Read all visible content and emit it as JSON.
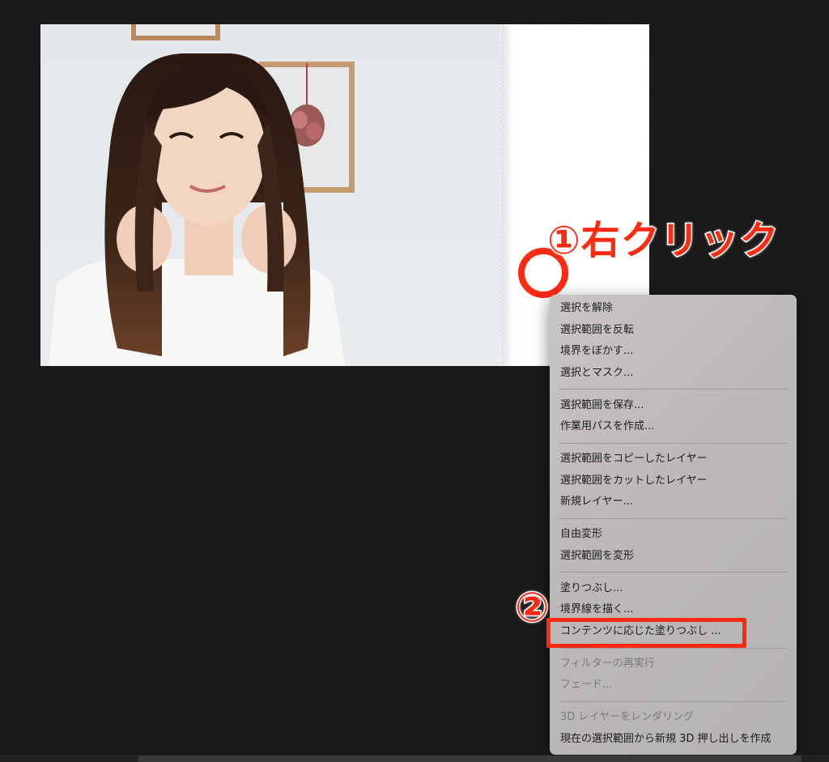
{
  "annotations": {
    "step1": "①右クリック",
    "step2": "②"
  },
  "context_menu": {
    "groups": [
      {
        "items": [
          {
            "label": "選択を解除",
            "enabled": true
          },
          {
            "label": "選択範囲を反転",
            "enabled": true
          },
          {
            "label": "境界をぼかす...",
            "enabled": true
          },
          {
            "label": "選択とマスク...",
            "enabled": true
          }
        ]
      },
      {
        "items": [
          {
            "label": "選択範囲を保存...",
            "enabled": true
          },
          {
            "label": "作業用パスを作成...",
            "enabled": true
          }
        ]
      },
      {
        "items": [
          {
            "label": "選択範囲をコピーしたレイヤー",
            "enabled": true
          },
          {
            "label": "選択範囲をカットしたレイヤー",
            "enabled": true
          },
          {
            "label": "新規レイヤー...",
            "enabled": true
          }
        ]
      },
      {
        "items": [
          {
            "label": "自由変形",
            "enabled": true
          },
          {
            "label": "選択範囲を変形",
            "enabled": true
          }
        ]
      },
      {
        "items": [
          {
            "label": "塗りつぶし...",
            "enabled": true
          },
          {
            "label": "境界線を描く...",
            "enabled": true
          },
          {
            "label": "コンテンツに応じた塗りつぶし ...",
            "enabled": true,
            "highlighted": true
          }
        ]
      },
      {
        "items": [
          {
            "label": "フィルターの再実行",
            "enabled": false
          },
          {
            "label": "フェード...",
            "enabled": false
          }
        ]
      },
      {
        "items": [
          {
            "label": "3D レイヤーをレンダリング",
            "enabled": false
          },
          {
            "label": "現在の選択範囲から新規 3D 押し出しを作成",
            "enabled": true
          }
        ]
      }
    ]
  },
  "colors": {
    "annotation_red": "#ff2a12",
    "canvas_background": "#1a1a1a"
  }
}
